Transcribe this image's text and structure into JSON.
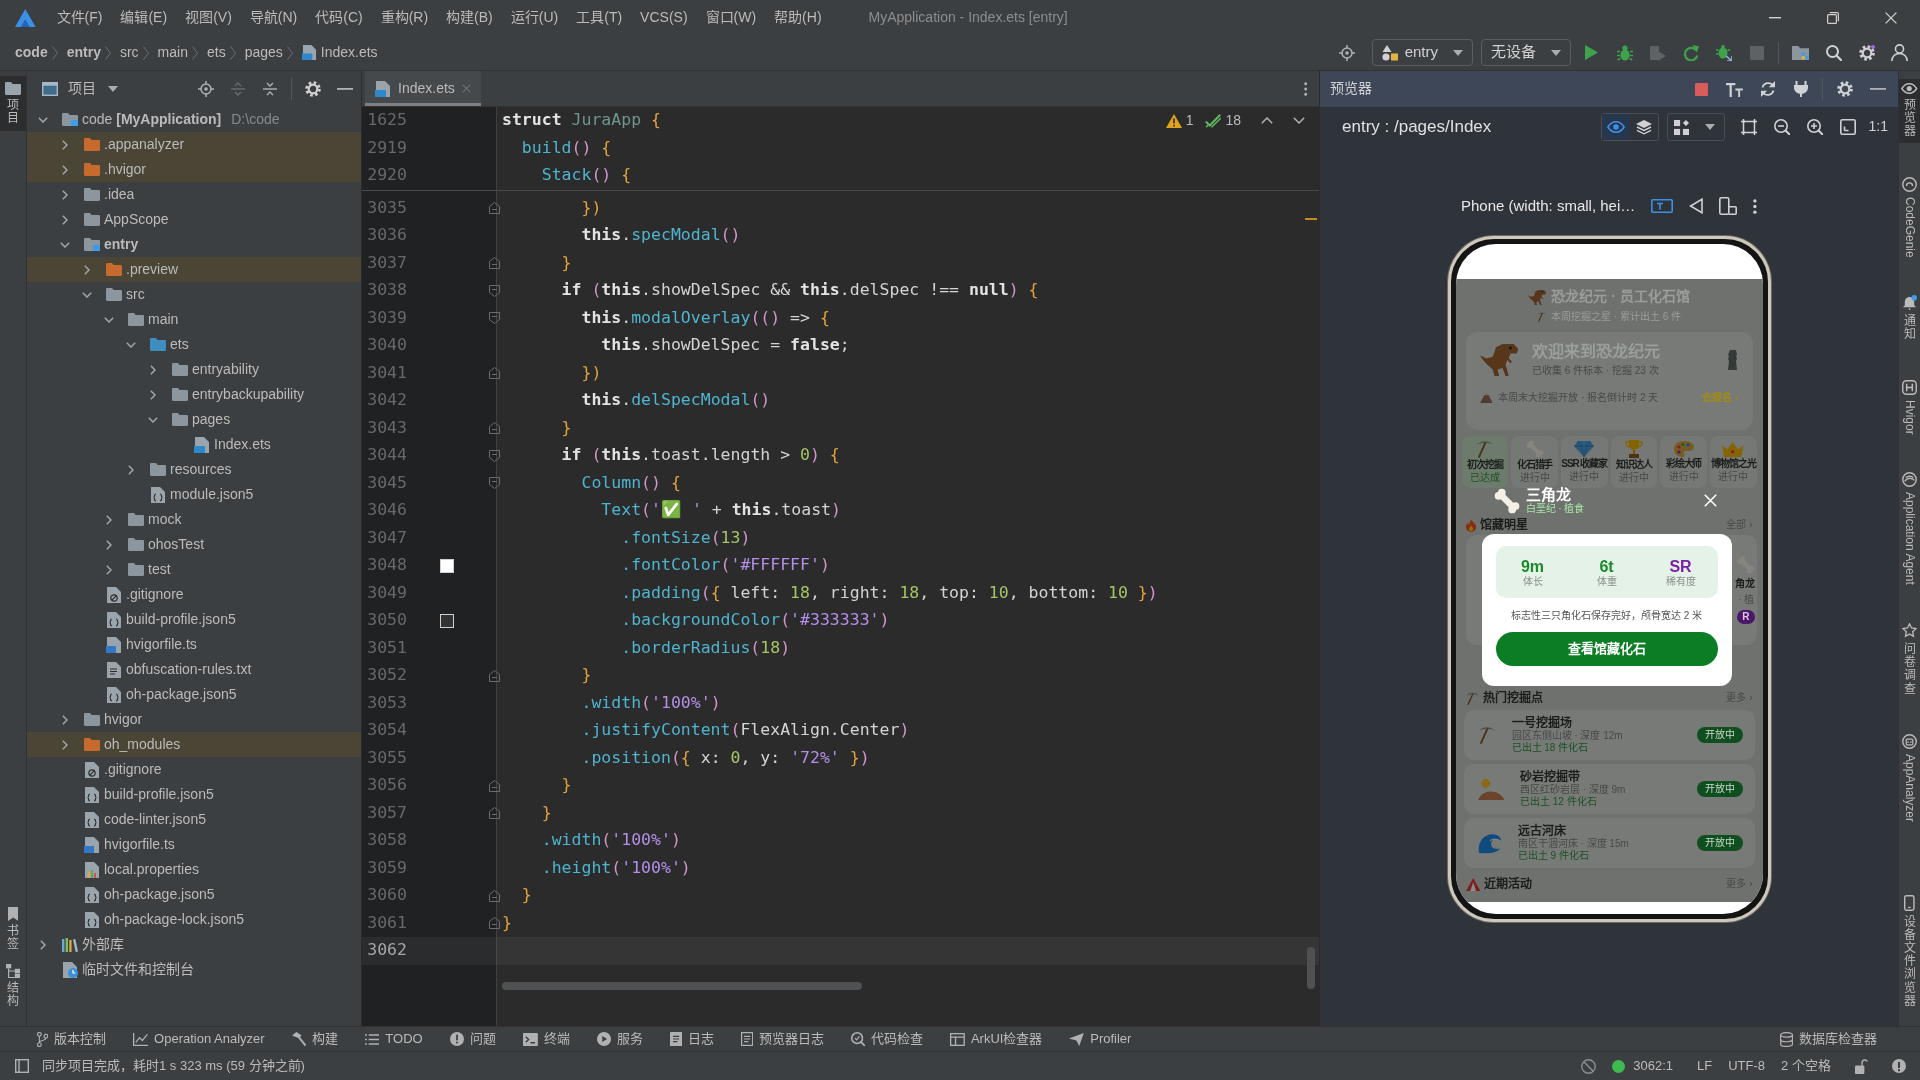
{
  "title_bar": {
    "menu": [
      "文件(F)",
      "编辑(E)",
      "视图(V)",
      "导航(N)",
      "代码(C)",
      "重构(R)",
      "构建(B)",
      "运行(U)",
      "工具(T)",
      "VCS(S)",
      "窗口(W)",
      "帮助(H)"
    ],
    "title": "MyApplication - Index.ets [entry]"
  },
  "navigation_bar": {
    "breadcrumb": [
      {
        "label": "code",
        "kind": "project"
      },
      {
        "label": "entry",
        "kind": "module"
      },
      {
        "label": "src",
        "kind": "folder"
      },
      {
        "label": "main",
        "kind": "folder"
      },
      {
        "label": "ets",
        "kind": "folder"
      },
      {
        "label": "pages",
        "kind": "folder"
      },
      {
        "label": "Index.ets",
        "kind": "file"
      }
    ],
    "run_configuration": "entry",
    "device": "无设备",
    "actions": [
      {
        "kind": "run",
        "disabled": false
      },
      {
        "kind": "debug",
        "disabled": false
      },
      {
        "kind": "profile",
        "disabled": true
      },
      {
        "kind": "apply",
        "disabled": false
      },
      {
        "kind": "attach",
        "disabled": false
      },
      {
        "kind": "stop",
        "disabled": true
      }
    ]
  },
  "left_stripe": [
    {
      "label": "项目",
      "kind": "project",
      "selected": true
    },
    {
      "label": "书签",
      "kind": "bookmarks",
      "selected": false
    },
    {
      "label": "结构",
      "kind": "structure",
      "selected": false
    }
  ],
  "project_panel": {
    "title": "项目",
    "tree": [
      {
        "label": "code **[MyApplication]**",
        "path": "D:\\code",
        "kind": "project",
        "expanded": true,
        "children": [
          {
            "label": ".appanalyzer",
            "kind": "excluded",
            "expanded": false
          },
          {
            "label": ".hvigor",
            "kind": "excluded",
            "expanded": false
          },
          {
            "label": ".idea",
            "kind": "folder",
            "expanded": false
          },
          {
            "label": "AppScope",
            "kind": "folder",
            "expanded": false
          },
          {
            "label": "entry",
            "kind": "module",
            "expanded": true,
            "children": [
              {
                "label": ".preview",
                "kind": "excluded",
                "expanded": false
              },
              {
                "label": "src",
                "kind": "folder",
                "expanded": true,
                "children": [
                  {
                    "label": "main",
                    "kind": "folder",
                    "expanded": true,
                    "children": [
                      {
                        "label": "ets",
                        "kind": "source",
                        "expanded": true,
                        "children": [
                          {
                            "label": "entryability",
                            "kind": "folder",
                            "expanded": false
                          },
                          {
                            "label": "entrybackupability",
                            "kind": "folder",
                            "expanded": false
                          },
                          {
                            "label": "pages",
                            "kind": "folder",
                            "expanded": true,
                            "children": [
                              {
                                "label": "Index.ets",
                                "kind": "ets"
                              }
                            ]
                          }
                        ]
                      },
                      {
                        "label": "resources",
                        "kind": "folder",
                        "expanded": false
                      },
                      {
                        "label": "module.json5",
                        "kind": "json5"
                      }
                    ]
                  },
                  {
                    "label": "mock",
                    "kind": "folder",
                    "expanded": false
                  },
                  {
                    "label": "ohosTest",
                    "kind": "folder",
                    "expanded": false
                  },
                  {
                    "label": "test",
                    "kind": "folder",
                    "expanded": false
                  }
                ]
              },
              {
                "label": ".gitignore",
                "kind": "ignore"
              },
              {
                "label": "build-profile.json5",
                "kind": "json5"
              },
              {
                "label": "hvigorfile.ts",
                "kind": "ts"
              },
              {
                "label": "obfuscation-rules.txt",
                "kind": "text"
              },
              {
                "label": "oh-package.json5",
                "kind": "json5"
              }
            ]
          },
          {
            "label": "hvigor",
            "kind": "folder",
            "expanded": false
          },
          {
            "label": "oh_modules",
            "kind": "excluded",
            "expanded": false
          },
          {
            "label": ".gitignore",
            "kind": "ignore"
          },
          {
            "label": "build-profile.json5",
            "kind": "json5"
          },
          {
            "label": "code-linter.json5",
            "kind": "json5"
          },
          {
            "label": "hvigorfile.ts",
            "kind": "ts"
          },
          {
            "label": "local.properties",
            "kind": "properties"
          },
          {
            "label": "oh-package.json5",
            "kind": "json5"
          },
          {
            "label": "oh-package-lock.json5",
            "kind": "json5"
          }
        ]
      },
      {
        "label": "外部库",
        "kind": "library",
        "expanded": false
      },
      {
        "label": "临时文件和控制台",
        "kind": "scratch"
      }
    ]
  },
  "editor": {
    "tabs": [
      {
        "label": "Index.ets",
        "selected": true
      }
    ],
    "inspections": {
      "warnings": "1",
      "passed": "18"
    },
    "sticky_lines": [
      {
        "number": "1625",
        "tokens": [
          {
            "kind": "key",
            "text": "struct"
          },
          {
            "kind": "type",
            "text": " JuraApp"
          },
          {
            "kind": "brace",
            "text": " {"
          }
        ]
      },
      {
        "number": "2919",
        "tokens": [
          {
            "kind": "call",
            "text": "  build"
          },
          {
            "kind": "paren",
            "text": "()"
          },
          {
            "kind": "brace",
            "text": " {"
          }
        ]
      },
      {
        "number": "2920",
        "tokens": [
          {
            "kind": "call",
            "text": "    Stack"
          },
          {
            "kind": "paren",
            "text": "()"
          },
          {
            "kind": "brace",
            "text": " {"
          }
        ]
      }
    ],
    "lines": [
      {
        "number": "3035",
        "current": false,
        "kind": "fold_end",
        "tokens": [
          {
            "kind": "brace",
            "text": "        })"
          }
        ]
      },
      {
        "number": "3036",
        "current": false,
        "kind": "plain",
        "tokens": [
          {
            "kind": "key",
            "text": "        this"
          },
          {
            "kind": "text",
            "text": "."
          },
          {
            "kind": "call",
            "text": "specModal"
          },
          {
            "kind": "paren",
            "text": "()"
          }
        ]
      },
      {
        "number": "3037",
        "current": false,
        "kind": "fold_end",
        "tokens": [
          {
            "kind": "brace",
            "text": "      }"
          }
        ]
      },
      {
        "number": "3038",
        "current": false,
        "kind": "fold_start",
        "tokens": [
          {
            "kind": "key",
            "text": "      if"
          },
          {
            "kind": "paren",
            "text": " ("
          },
          {
            "kind": "key",
            "text": "this"
          },
          {
            "kind": "text",
            "text": ".showDelSpec && "
          },
          {
            "kind": "key",
            "text": "this"
          },
          {
            "kind": "text",
            "text": ".delSpec !== "
          },
          {
            "kind": "key",
            "text": "null"
          },
          {
            "kind": "paren",
            "text": ")"
          },
          {
            "kind": "brace",
            "text": " {"
          }
        ]
      },
      {
        "number": "3039",
        "current": false,
        "kind": "fold_start",
        "tokens": [
          {
            "kind": "key",
            "text": "        this"
          },
          {
            "kind": "text",
            "text": "."
          },
          {
            "kind": "call",
            "text": "modalOverlay"
          },
          {
            "kind": "paren",
            "text": "(()"
          },
          {
            "kind": "text",
            "text": " => "
          },
          {
            "kind": "brace",
            "text": "{"
          }
        ]
      },
      {
        "number": "3040",
        "current": false,
        "kind": "plain",
        "tokens": [
          {
            "kind": "key",
            "text": "          this"
          },
          {
            "kind": "text",
            "text": ".showDelSpec = "
          },
          {
            "kind": "key",
            "text": "false"
          },
          {
            "kind": "text",
            "text": ";"
          }
        ]
      },
      {
        "number": "3041",
        "current": false,
        "kind": "fold_end",
        "tokens": [
          {
            "kind": "brace",
            "text": "        })"
          }
        ]
      },
      {
        "number": "3042",
        "current": false,
        "kind": "plain",
        "tokens": [
          {
            "kind": "key",
            "text": "        this"
          },
          {
            "kind": "text",
            "text": "."
          },
          {
            "kind": "call",
            "text": "delSpecModal"
          },
          {
            "kind": "paren",
            "text": "()"
          }
        ]
      },
      {
        "number": "3043",
        "current": false,
        "kind": "fold_end",
        "tokens": [
          {
            "kind": "brace",
            "text": "      }"
          }
        ]
      },
      {
        "number": "3044",
        "current": false,
        "kind": "fold_start",
        "tokens": [
          {
            "kind": "key",
            "text": "      if"
          },
          {
            "kind": "paren",
            "text": " ("
          },
          {
            "kind": "key",
            "text": "this"
          },
          {
            "kind": "text",
            "text": ".toast.length > "
          },
          {
            "kind": "num",
            "text": "0"
          },
          {
            "kind": "paren",
            "text": ")"
          },
          {
            "kind": "brace",
            "text": " {"
          }
        ]
      },
      {
        "number": "3045",
        "current": false,
        "kind": "fold_start",
        "tokens": [
          {
            "kind": "call",
            "text": "        Column"
          },
          {
            "kind": "paren",
            "text": "()"
          },
          {
            "kind": "brace",
            "text": " {"
          }
        ]
      },
      {
        "number": "3046",
        "current": false,
        "kind": "plain",
        "tokens": [
          {
            "kind": "call",
            "text": "          Text"
          },
          {
            "kind": "paren",
            "text": "("
          },
          {
            "kind": "str",
            "text": "'✅ '"
          },
          {
            "kind": "text",
            "text": " + "
          },
          {
            "kind": "key",
            "text": "this"
          },
          {
            "kind": "text",
            "text": ".toast"
          },
          {
            "kind": "paren",
            "text": ")"
          }
        ]
      },
      {
        "number": "3047",
        "current": false,
        "kind": "plain",
        "tokens": [
          {
            "kind": "call",
            "text": "            .fontSize"
          },
          {
            "kind": "paren",
            "text": "("
          },
          {
            "kind": "num",
            "text": "13"
          },
          {
            "kind": "paren",
            "text": ")"
          }
        ]
      },
      {
        "number": "3048",
        "current": false,
        "kind": "plain",
        "color": "#ffffff",
        "tokens": [
          {
            "kind": "call",
            "text": "            .fontColor"
          },
          {
            "kind": "paren",
            "text": "("
          },
          {
            "kind": "str",
            "text": "'#FFFFFF'"
          },
          {
            "kind": "paren",
            "text": ")"
          }
        ]
      },
      {
        "number": "3049",
        "current": false,
        "kind": "plain",
        "tokens": [
          {
            "kind": "call",
            "text": "            .padding"
          },
          {
            "kind": "paren",
            "text": "("
          },
          {
            "kind": "brace",
            "text": "{"
          },
          {
            "kind": "text",
            "text": " left: "
          },
          {
            "kind": "num",
            "text": "18"
          },
          {
            "kind": "text",
            "text": ", right: "
          },
          {
            "kind": "num",
            "text": "18"
          },
          {
            "kind": "text",
            "text": ", top: "
          },
          {
            "kind": "num",
            "text": "10"
          },
          {
            "kind": "text",
            "text": ", bottom: "
          },
          {
            "kind": "num",
            "text": "10"
          },
          {
            "kind": "brace",
            "text": " }"
          },
          {
            "kind": "paren",
            "text": ")"
          }
        ]
      },
      {
        "number": "3050",
        "current": false,
        "kind": "plain",
        "color": "#333333",
        "tokens": [
          {
            "kind": "call",
            "text": "            .backgroundColor"
          },
          {
            "kind": "paren",
            "text": "("
          },
          {
            "kind": "str",
            "text": "'#333333'"
          },
          {
            "kind": "paren",
            "text": ")"
          }
        ]
      },
      {
        "number": "3051",
        "current": false,
        "kind": "plain",
        "tokens": [
          {
            "kind": "call",
            "text": "            .borderRadius"
          },
          {
            "kind": "paren",
            "text": "("
          },
          {
            "kind": "num",
            "text": "18"
          },
          {
            "kind": "paren",
            "text": ")"
          }
        ]
      },
      {
        "number": "3052",
        "current": false,
        "kind": "fold_end",
        "tokens": [
          {
            "kind": "brace",
            "text": "        }"
          }
        ]
      },
      {
        "number": "3053",
        "current": false,
        "kind": "plain",
        "tokens": [
          {
            "kind": "call",
            "text": "        .width"
          },
          {
            "kind": "paren",
            "text": "("
          },
          {
            "kind": "str",
            "text": "'100%'"
          },
          {
            "kind": "paren",
            "text": ")"
          }
        ]
      },
      {
        "number": "3054",
        "current": false,
        "kind": "plain",
        "tokens": [
          {
            "kind": "call",
            "text": "        .justifyContent"
          },
          {
            "kind": "paren",
            "text": "("
          },
          {
            "kind": "text",
            "text": "FlexAlign.Center"
          },
          {
            "kind": "paren",
            "text": ")"
          }
        ]
      },
      {
        "number": "3055",
        "current": false,
        "kind": "plain",
        "tokens": [
          {
            "kind": "call",
            "text": "        .position"
          },
          {
            "kind": "paren",
            "text": "("
          },
          {
            "kind": "brace",
            "text": "{"
          },
          {
            "kind": "text",
            "text": " x: "
          },
          {
            "kind": "num",
            "text": "0"
          },
          {
            "kind": "text",
            "text": ", y: "
          },
          {
            "kind": "str",
            "text": "'72%'"
          },
          {
            "kind": "brace",
            "text": " }"
          },
          {
            "kind": "paren",
            "text": ")"
          }
        ]
      },
      {
        "number": "3056",
        "current": false,
        "kind": "fold_end",
        "tokens": [
          {
            "kind": "brace",
            "text": "      }"
          }
        ]
      },
      {
        "number": "3057",
        "current": false,
        "kind": "fold_end",
        "tokens": [
          {
            "kind": "brace",
            "text": "    }"
          }
        ]
      },
      {
        "number": "3058",
        "current": false,
        "kind": "plain",
        "tokens": [
          {
            "kind": "call",
            "text": "    .width"
          },
          {
            "kind": "paren",
            "text": "("
          },
          {
            "kind": "str",
            "text": "'100%'"
          },
          {
            "kind": "paren",
            "text": ")"
          }
        ]
      },
      {
        "number": "3059",
        "current": false,
        "kind": "plain",
        "tokens": [
          {
            "kind": "call",
            "text": "    .height"
          },
          {
            "kind": "paren",
            "text": "("
          },
          {
            "kind": "str",
            "text": "'100%'"
          },
          {
            "kind": "paren",
            "text": ")"
          }
        ]
      },
      {
        "number": "3060",
        "current": false,
        "kind": "fold_end",
        "tokens": [
          {
            "kind": "brace",
            "text": "  }"
          }
        ]
      },
      {
        "number": "3061",
        "current": false,
        "kind": "fold_end",
        "tokens": [
          {
            "kind": "brace",
            "text": "}"
          }
        ]
      },
      {
        "number": "3062",
        "current": true,
        "kind": "plain"
      }
    ]
  },
  "preview": {
    "title": "预览器",
    "route": "entry : /pages/Index",
    "actual_size": "1:1",
    "device": "Phone (width: small, hei…",
    "phone": {
      "app": {
        "title": "恐龙纪元 · 员工化石馆",
        "subtitle": "本周挖掘之星 · 累计出土 6 件",
        "welcome": {
          "title": "欢迎来到恐龙纪元",
          "stats": "已收集 6 件标本 · 挖掘 23 次",
          "notice": "本周末大挖掘开放 · 报名倒计时 2 天",
          "action": "去报名 ›"
        },
        "achievements": [
          {
            "kind": "pickaxe",
            "label": "初次挖掘",
            "status": "已达成",
            "achieved": true
          },
          {
            "kind": "bone",
            "label": "化石猎手",
            "status": "进行中",
            "achieved": false
          },
          {
            "kind": "gem",
            "label": "SSR 收藏家",
            "status": "进行中",
            "achieved": false
          },
          {
            "kind": "trophy",
            "label": "知识达人",
            "status": "进行中",
            "achieved": false
          },
          {
            "kind": "palette",
            "label": "彩绘大师",
            "status": "进行中",
            "achieved": false
          },
          {
            "kind": "crown",
            "label": "博物馆之光",
            "status": "进行中",
            "achieved": false
          }
        ],
        "featured": {
          "title": "馆藏明星",
          "more": "全部 ›",
          "cards": [
            {
              "name": "角龙",
              "detail": "· 植",
              "rarity": "R"
            }
          ]
        },
        "sites": {
          "title": "热门挖掘点",
          "more": "更多 ›",
          "items": [
            {
              "kind": "pickaxe",
              "name": "一号挖掘场",
              "detail": "园区东侧山坡 · 深度 12m",
              "found": "已出土 18 件化石",
              "status": "开放中"
            },
            {
              "kind": "desert",
              "name": "砂岩挖掘带",
              "detail": "西区红砂岩层 · 深度 9m",
              "found": "已出土 12 件化石",
              "status": "开放中"
            },
            {
              "kind": "wave",
              "name": "远古河床",
              "detail": "南区干涸河床 · 深度 15m",
              "found": "已出土 9 件化石",
              "status": "开放中"
            }
          ]
        },
        "events": {
          "title": "近期活动",
          "more": "更多 ›"
        }
      },
      "modal": {
        "name": "三角龙",
        "subtitle": "白垩纪 · 植食",
        "stats": [
          {
            "value": "9m",
            "label": "体长",
            "color": "#1b8a2e"
          },
          {
            "value": "6t",
            "label": "体重",
            "color": "#1b8a2e"
          },
          {
            "value": "SR",
            "label": "稀有度",
            "color": "#7a1fa8"
          }
        ],
        "description": "标志性三只角化石保存完好，颅骨宽达 2 米",
        "button": "查看馆藏化石"
      }
    }
  },
  "right_stripe": [
    {
      "label": "预览器",
      "kind": "preview",
      "selected": true
    },
    {
      "label": "CodeGenie",
      "kind": "codegenie",
      "selected": false
    },
    {
      "label": "通知",
      "kind": "notifications",
      "selected": false
    },
    {
      "label": "Hvigor",
      "kind": "hvigor",
      "selected": false
    },
    {
      "label": "Application Agent",
      "kind": "agent",
      "selected": false
    },
    {
      "label": "问卷调查",
      "kind": "survey",
      "selected": false
    },
    {
      "label": "AppAnalyzer",
      "kind": "analyzer",
      "selected": false
    },
    {
      "label": "设备文件浏览器",
      "kind": "device_files",
      "selected": false
    }
  ],
  "tool_windows": {
    "left": [
      {
        "label": "版本控制",
        "kind": "vcs"
      },
      {
        "label": "Operation Analyzer",
        "kind": "analyzer"
      },
      {
        "label": "构建",
        "kind": "build"
      },
      {
        "label": "TODO",
        "kind": "todo"
      },
      {
        "label": "问题",
        "kind": "problems"
      },
      {
        "label": "终端",
        "kind": "terminal"
      },
      {
        "label": "服务",
        "kind": "services"
      },
      {
        "label": "日志",
        "kind": "log"
      },
      {
        "label": "预览器日志",
        "kind": "preview_log"
      },
      {
        "label": "代码检查",
        "kind": "inspect"
      },
      {
        "label": "ArkUI检查器",
        "kind": "arkui"
      },
      {
        "label": "Profiler",
        "kind": "profiler"
      }
    ],
    "right": [
      {
        "label": "数据库检查器",
        "kind": "database"
      }
    ]
  },
  "status_bar": {
    "message": "同步项目完成，耗时1 s 323 ms (59 分钟之前)",
    "position": "3062:1",
    "line_separator": "LF",
    "encoding": "UTF-8",
    "indent": "2 个空格"
  }
}
